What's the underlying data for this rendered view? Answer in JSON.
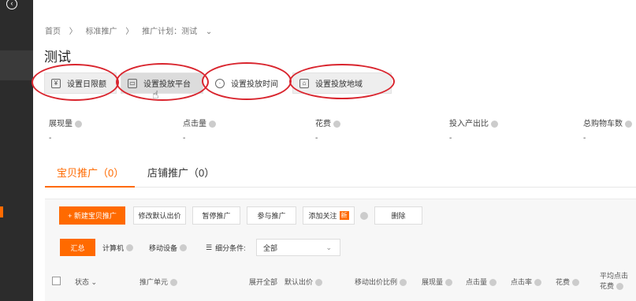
{
  "breadcrumb": [
    "首页",
    "标准推广",
    "推广计划：测试"
  ],
  "breadcrumb_sep": "〉",
  "page_title": "测试",
  "toolbar": [
    {
      "label": "设置日限额",
      "icon": "budget-icon"
    },
    {
      "label": "设置投放平台",
      "icon": "platform-icon"
    },
    {
      "label": "设置投放时间",
      "icon": "clock-icon"
    },
    {
      "label": "设置投放地域",
      "icon": "region-icon"
    }
  ],
  "metrics": [
    {
      "label": "展现量",
      "value": "-"
    },
    {
      "label": "点击量",
      "value": "-"
    },
    {
      "label": "花费",
      "value": "-"
    },
    {
      "label": "投入产出比",
      "value": "-"
    },
    {
      "label": "总购物车数",
      "value": "-"
    }
  ],
  "tabs": [
    {
      "label": "宝贝推广（0）",
      "active": true
    },
    {
      "label": "店铺推广（0）",
      "active": false
    }
  ],
  "actions": {
    "new": "+ 新建宝贝推广",
    "edit_bid": "修改默认出价",
    "pause": "暂停推广",
    "join": "参与推广",
    "follow": "添加关注",
    "follow_badge": "新",
    "delete": "删除"
  },
  "segments": {
    "summary": "汇总",
    "computer": "计算机",
    "mobile": "移动设备",
    "filter_label": "细分条件:",
    "filter_value": "全部"
  },
  "table_headers": {
    "status": "状态",
    "unit": "推广单元",
    "expand": "展开全部",
    "default_bid": "默认出价",
    "mobile_ratio": "移动出价比例",
    "impressions": "展现量",
    "clicks": "点击量",
    "ctr": "点击率",
    "cost": "花费",
    "avg_click_1": "平均点击",
    "avg_click_2": "花费"
  },
  "colors": {
    "accent": "#ff6a00",
    "annotation": "#d9252e"
  }
}
